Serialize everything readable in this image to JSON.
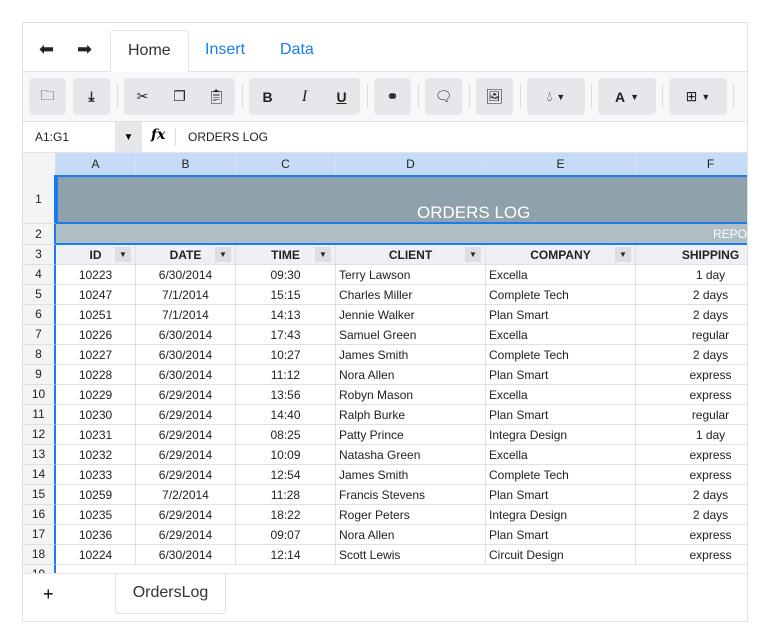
{
  "ribbon": {
    "tabs": [
      "Home",
      "Insert",
      "Data"
    ],
    "active": "Home",
    "undo_icon": "undo-icon",
    "redo_icon": "redo-icon"
  },
  "toolbar": {
    "buttons": [
      "open",
      "download",
      "cut",
      "copy",
      "paste",
      "bold",
      "italic",
      "underline",
      "hyperlink",
      "comment",
      "image",
      "fill-color",
      "font-color",
      "borders"
    ],
    "bold": "B",
    "italic": "I",
    "underline": "U",
    "font_color": "A"
  },
  "formula_bar": {
    "name_box": "A1:G1",
    "fx": "fx",
    "value": "ORDERS LOG"
  },
  "accent": "#1a7cf0",
  "grid": {
    "columns": [
      "A",
      "B",
      "C",
      "D",
      "E",
      "F"
    ],
    "title": "ORDERS LOG",
    "subtitle": "REPO",
    "headers": [
      "ID",
      "DATE",
      "TIME",
      "CLIENT",
      "COMPANY",
      "SHIPPING"
    ],
    "rows": [
      [
        "10223",
        "6/30/2014",
        "09:30",
        "Terry Lawson",
        "Excella",
        "1 day"
      ],
      [
        "10247",
        "7/1/2014",
        "15:15",
        "Charles Miller",
        "Complete Tech",
        "2 days"
      ],
      [
        "10251",
        "7/1/2014",
        "14:13",
        "Jennie Walker",
        "Plan Smart",
        "2 days"
      ],
      [
        "10226",
        "6/30/2014",
        "17:43",
        "Samuel Green",
        "Excella",
        "regular"
      ],
      [
        "10227",
        "6/30/2014",
        "10:27",
        "James Smith",
        "Complete Tech",
        "2 days"
      ],
      [
        "10228",
        "6/30/2014",
        "11:12",
        "Nora Allen",
        "Plan Smart",
        "express"
      ],
      [
        "10229",
        "6/29/2014",
        "13:56",
        "Robyn Mason",
        "Excella",
        "express"
      ],
      [
        "10230",
        "6/29/2014",
        "14:40",
        "Ralph Burke",
        "Plan Smart",
        "regular"
      ],
      [
        "10231",
        "6/29/2014",
        "08:25",
        "Patty Prince",
        "Integra Design",
        "1 day"
      ],
      [
        "10232",
        "6/29/2014",
        "10:09",
        "Natasha Green",
        "Excella",
        "express"
      ],
      [
        "10233",
        "6/29/2014",
        "12:54",
        "James Smith",
        "Complete Tech",
        "express"
      ],
      [
        "10259",
        "7/2/2014",
        "11:28",
        "Francis Stevens",
        "Plan Smart",
        "2 days"
      ],
      [
        "10235",
        "6/29/2014",
        "18:22",
        "Roger Peters",
        "Integra Design",
        "2 days"
      ],
      [
        "10236",
        "6/29/2014",
        "09:07",
        "Nora Allen",
        "Plan Smart",
        "express"
      ],
      [
        "10224",
        "6/30/2014",
        "12:14",
        "Scott Lewis",
        "Circuit Design",
        "express"
      ]
    ]
  },
  "sheets": {
    "add": "+",
    "tabs": [
      "OrdersLog"
    ]
  }
}
